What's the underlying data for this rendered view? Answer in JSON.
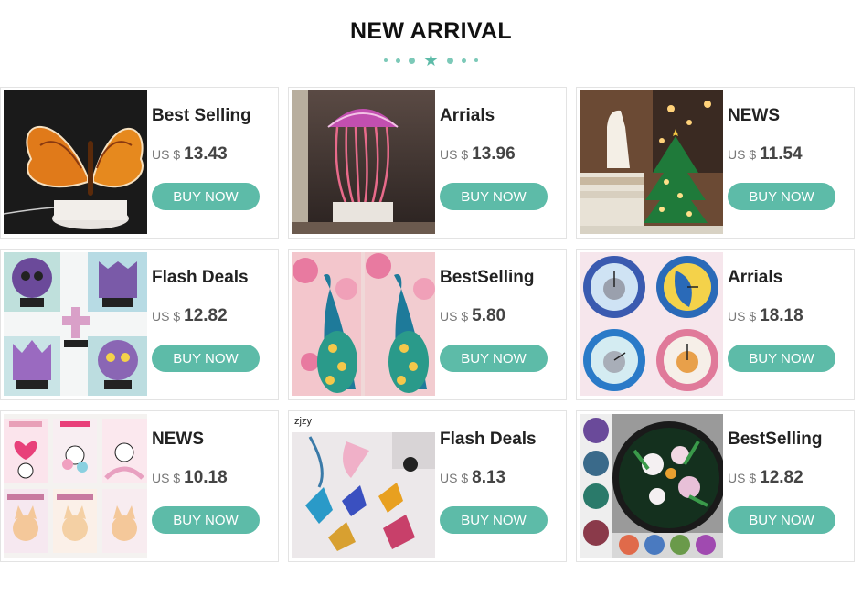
{
  "header": {
    "title": "NEW ARRIVAL"
  },
  "buy_label": "BUY NOW",
  "accent_color": "#5dbba8",
  "products": [
    {
      "title": "Best Selling",
      "currency": "US $",
      "price": "13.43",
      "image": "butterfly-lamp"
    },
    {
      "title": "Arrials",
      "currency": "US $",
      "price": "13.96",
      "image": "jellyfish-lamp"
    },
    {
      "title": "NEWS",
      "currency": "US $",
      "price": "11.54",
      "image": "llama-christmas-tree-lamp"
    },
    {
      "title": "Flash Deals",
      "currency": "US $",
      "price": "12.82",
      "image": "animal-lamps-set"
    },
    {
      "title": "BestSelling",
      "currency": "US $",
      "price": "5.80",
      "image": "peacock-paintings"
    },
    {
      "title": "Arrials",
      "currency": "US $",
      "price": "18.18",
      "image": "cat-clocks"
    },
    {
      "title": "NEWS",
      "currency": "US $",
      "price": "10.18",
      "image": "greeting-cards"
    },
    {
      "title": "Flash Deals",
      "currency": "US $",
      "price": "8.13",
      "image": "butterfly-keychains",
      "image_tag": "zjzy"
    },
    {
      "title": "BestSelling",
      "currency": "US $",
      "price": "12.82",
      "image": "flower-clocks"
    }
  ]
}
